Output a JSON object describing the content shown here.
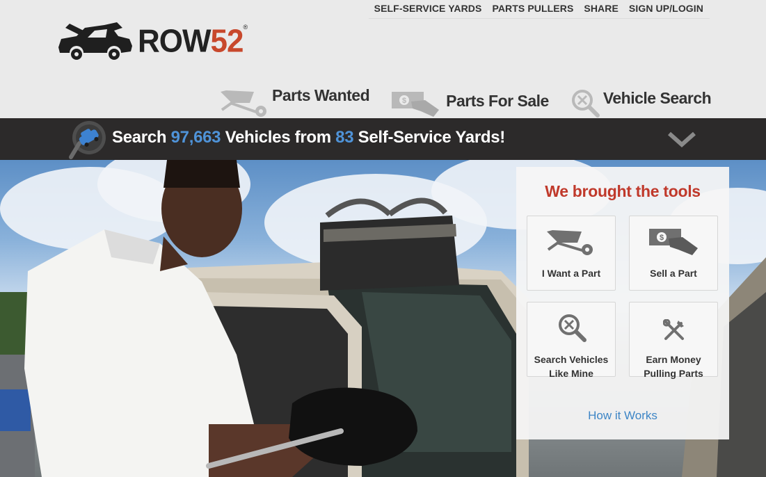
{
  "brand": {
    "name_prefix": "ROW",
    "name_number": "52",
    "reg": "®"
  },
  "topnav": [
    "SELF-SERVICE YARDS",
    "PARTS PULLERS",
    "SHARE",
    "SIGN UP/LOGIN"
  ],
  "mainnav": [
    {
      "label": "Parts Wanted",
      "icon": "wheelbarrow-icon"
    },
    {
      "label": "Parts For Sale",
      "icon": "money-hand-icon"
    },
    {
      "label": "Vehicle Search",
      "icon": "magnifier-icon"
    }
  ],
  "searchbar": {
    "prefix": "Search ",
    "vehicles_count": "97,663",
    "middle": " Vehicles from ",
    "yards_count": "83",
    "suffix": " Self-Service Yards!"
  },
  "tools": {
    "title": "We brought the tools",
    "items": [
      {
        "line1": "I Want a Part",
        "line2": "",
        "icon": "wheelbarrow-icon"
      },
      {
        "line1": "Sell a Part",
        "line2": "",
        "icon": "money-hand-icon"
      },
      {
        "line1": "Search Vehicles",
        "line2": "Like Mine",
        "icon": "magnifier-icon"
      },
      {
        "line1": "Earn Money",
        "line2": "Pulling Parts",
        "icon": "tools-icon"
      }
    ],
    "how_it_works": "How it Works"
  },
  "colors": {
    "accent_red": "#c0392b",
    "accent_blue": "#4f93d8",
    "bar_dark": "#2c2a2a"
  }
}
